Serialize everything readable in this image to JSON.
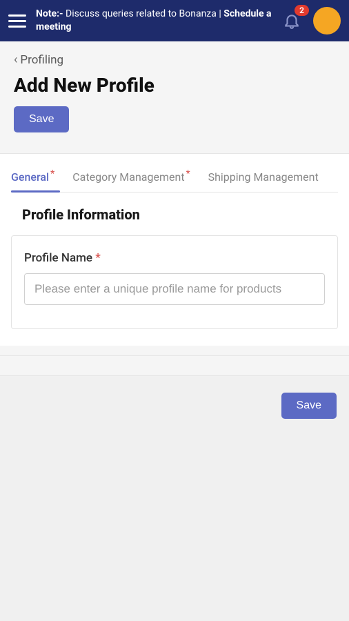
{
  "header": {
    "note_prefix": "Note:-",
    "note_text": "Discuss queries related to Bonanza |",
    "schedule_text": "Schedule a meeting",
    "badge_count": "2"
  },
  "breadcrumb": {
    "label": "Profiling"
  },
  "page": {
    "title": "Add New Profile",
    "save_label": "Save"
  },
  "tabs": {
    "general": "General",
    "category": "Category Management",
    "shipping": "Shipping Management"
  },
  "section": {
    "title": "Profile Information"
  },
  "form": {
    "profile_name_label": "Profile Name",
    "profile_name_placeholder": "Please enter a unique profile name for products"
  },
  "footer": {
    "save_label": "Save"
  },
  "colors": {
    "primary": "#5c6ac4",
    "header_bg": "#1e2b6b",
    "badge": "#e23a2e",
    "avatar": "#f5a623"
  }
}
